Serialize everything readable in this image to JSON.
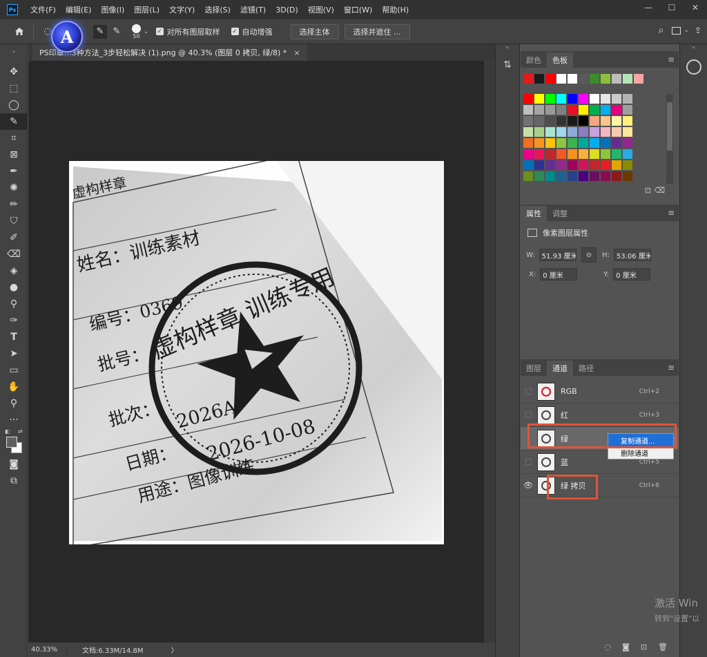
{
  "app": {
    "logo": "Ps"
  },
  "menus": [
    "文件(F)",
    "编辑(E)",
    "图像(I)",
    "图层(L)",
    "文字(Y)",
    "选择(S)",
    "滤镜(T)",
    "3D(D)",
    "视图(V)",
    "窗口(W)",
    "帮助(H)"
  ],
  "window_controls": [
    "—",
    "☐",
    "✕"
  ],
  "options": {
    "brush_size": "50",
    "sample_all_label": "对所有图层取样",
    "auto_enhance_label": "自动增强",
    "select_subject_label": "选择主体",
    "select_mask_label": "选择并遮住 ..."
  },
  "badge": {
    "letter": "A"
  },
  "document": {
    "tab_title": "PS印章…3种方法_3步轻松解决 (1).png @ 40.3% (图层 0 拷贝, 绿/8) *",
    "close": "×"
  },
  "image_text": {
    "header": "虚构样章",
    "name": "姓名：训练素材",
    "number": "编号：0369",
    "batch_no": "批号：",
    "batch": "批次：",
    "date": "日期：",
    "usage": "用途：图像训练",
    "stamp_top": "虚构样章 训练专用",
    "stamp_code": "2026A",
    "stamp_date": "2026-10-08"
  },
  "status": {
    "zoom": "40.33%",
    "docsize": "文档:6.33M/14.8M",
    "arrow": "〉"
  },
  "swatches_panel": {
    "tabs": [
      "颜色",
      "色板"
    ],
    "active_tab": 1,
    "recent": [
      "#e21b1b",
      "#1a1a1a",
      "#ff0000",
      "#ffffff",
      "#ffffff",
      "#5a5a5a",
      "#3c8c2a",
      "#8fbf3a",
      "#bdbdbd",
      "#b3e6b3",
      "#f6a6a6"
    ],
    "grid": [
      "#ff0000",
      "#ffff00",
      "#00ff00",
      "#00ffff",
      "#0000ff",
      "#ff00ff",
      "#ffffff",
      "#e6e6e6",
      "#cccccc",
      "#b3b3b3",
      "#bfbfbf",
      "#a6a6a6",
      "#999999",
      "#808080",
      "#e81123",
      "#ffef00",
      "#00b050",
      "#00b0f0",
      "#e4007f",
      "#9e9e9e",
      "#737373",
      "#666666",
      "#4d4d4d",
      "#333333",
      "#1a1a1a",
      "#000000",
      "#f4a582",
      "#fcc589",
      "#fff5a5",
      "#fff078",
      "#c5e0a5",
      "#a9d18e",
      "#a8e6cf",
      "#9fd8ef",
      "#8faadc",
      "#8e7cc3",
      "#c9a0dc",
      "#f4b6c2",
      "#f8cbad",
      "#ffe699",
      "#f36f21",
      "#f7941d",
      "#ffc20e",
      "#8dc63f",
      "#39b54a",
      "#00a99d",
      "#00aeef",
      "#0072bc",
      "#662d91",
      "#92278f",
      "#ec008c",
      "#ed145b",
      "#c1272d",
      "#f15a24",
      "#f7931e",
      "#fbb03b",
      "#d9e021",
      "#8cc63f",
      "#22b573",
      "#29abe2",
      "#0071bc",
      "#2e3192",
      "#662d91",
      "#93278f",
      "#9e005d",
      "#d4145a",
      "#c1272d",
      "#ed1c24",
      "#e2a400",
      "#8b8b00",
      "#6b8e23",
      "#2e8b57",
      "#008b8b",
      "#1e6091",
      "#27408b",
      "#4b0082",
      "#6a0d5f",
      "#8b0a50",
      "#8b1a1a",
      "#6b3a00"
    ]
  },
  "properties_panel": {
    "tabs": [
      "属性",
      "调整"
    ],
    "active_tab": 0,
    "header": "像素图层属性",
    "w_label": "W:",
    "w_value": "51.93 厘米",
    "h_label": "H:",
    "h_value": "53.06 厘米",
    "x_label": "X:",
    "x_value": "0 厘米",
    "y_label": "Y:",
    "y_value": "0 厘米",
    "link_icon": "⊖"
  },
  "channels_panel": {
    "tabs": [
      "图层",
      "通道",
      "路径"
    ],
    "active_tab": 1,
    "rows": [
      {
        "name": "RGB",
        "shortcut": "Ctrl+2"
      },
      {
        "name": "红",
        "shortcut": "Ctrl+3"
      },
      {
        "name": "绿",
        "shortcut": ""
      },
      {
        "name": "蓝",
        "shortcut": "Ctrl+5"
      },
      {
        "name": "绿 拷贝",
        "shortcut": "Ctrl+6"
      }
    ],
    "context_menu": [
      "复制通道...",
      "删除通道"
    ],
    "footer_icons": [
      "◌",
      "◙",
      "⊡",
      "🗑"
    ]
  },
  "watermark": {
    "line1": "激活 Win",
    "line2": "转到\"设置\"以"
  }
}
